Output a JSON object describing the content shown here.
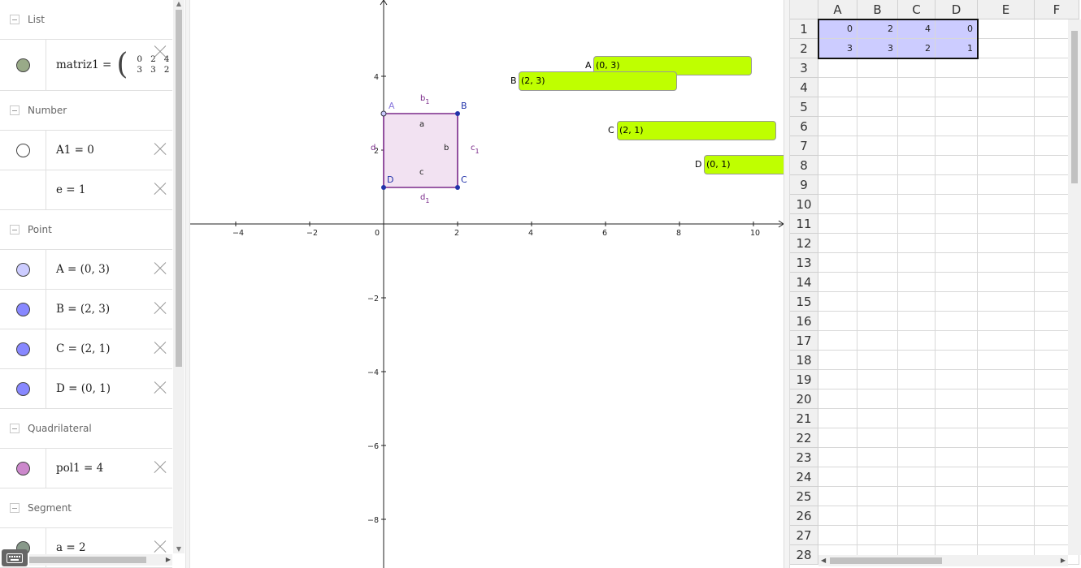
{
  "algebra": {
    "categories": {
      "list": "List",
      "number": "Number",
      "point": "Point",
      "quadrilateral": "Quadrilateral",
      "segment": "Segment"
    },
    "matrix": {
      "name": "matriz1 =",
      "rows": [
        [
          "0",
          "2",
          "4",
          "0"
        ],
        [
          "3",
          "3",
          "2",
          "1"
        ]
      ],
      "color": "#99aa88"
    },
    "numbers": [
      {
        "text": "A1 = 0",
        "color": "#ffffff"
      },
      {
        "text": "e = 1",
        "color": null
      }
    ],
    "points": [
      {
        "text": "A = (0, 3)",
        "color": "#ccccff"
      },
      {
        "text": "B = (2, 3)",
        "color": "#8888ff"
      },
      {
        "text": "C = (2, 1)",
        "color": "#8888ff"
      },
      {
        "text": "D = (0, 1)",
        "color": "#8888ff"
      }
    ],
    "quadrilateral": {
      "text": "pol1 = 4",
      "color": "#cc88cc"
    },
    "segment": {
      "text": "a = 2",
      "color": "#88998a"
    }
  },
  "graphics": {
    "axes": {
      "x_ticks": [
        "−4",
        "−2",
        "0",
        "2",
        "4",
        "6",
        "8",
        "10"
      ],
      "y_ticks": [
        "4",
        "2",
        "−2",
        "−4",
        "−6",
        "−8"
      ]
    },
    "polygon": {
      "vertices": [
        [
          0,
          3
        ],
        [
          2,
          3
        ],
        [
          2,
          1
        ],
        [
          0,
          1
        ]
      ],
      "fill": "#f2e2f2",
      "stroke": "#7a2a8a"
    },
    "vertex_labels": {
      "A": "A",
      "B": "B",
      "C": "C",
      "D": "D"
    },
    "segment_labels": {
      "a": "a",
      "b": "b",
      "c": "c",
      "d": "d",
      "b1": "b",
      "c1": "c",
      "d1": "d",
      "d1_left": "d",
      "sub": "1"
    },
    "point_boxes": [
      {
        "label": "A",
        "text": "(0, 3)"
      },
      {
        "label": "B",
        "text": "(2, 3)"
      },
      {
        "label": "C",
        "text": "(2, 1)"
      },
      {
        "label": "D",
        "text": "(0, 1)"
      }
    ],
    "box_color": "#bfff00"
  },
  "spreadsheet": {
    "columns": [
      "A",
      "B",
      "C",
      "D",
      "E",
      "F"
    ],
    "rows": [
      "1",
      "2",
      "3",
      "4",
      "5",
      "6",
      "7",
      "8",
      "9",
      "10",
      "11",
      "12",
      "13",
      "14",
      "15",
      "16",
      "17",
      "18",
      "19",
      "20",
      "21",
      "22",
      "23",
      "24",
      "25",
      "26",
      "27",
      "28"
    ],
    "values": [
      [
        "0",
        "2",
        "4",
        "0"
      ],
      [
        "3",
        "3",
        "2",
        "1"
      ]
    ],
    "selection_color": "#ccccff"
  }
}
